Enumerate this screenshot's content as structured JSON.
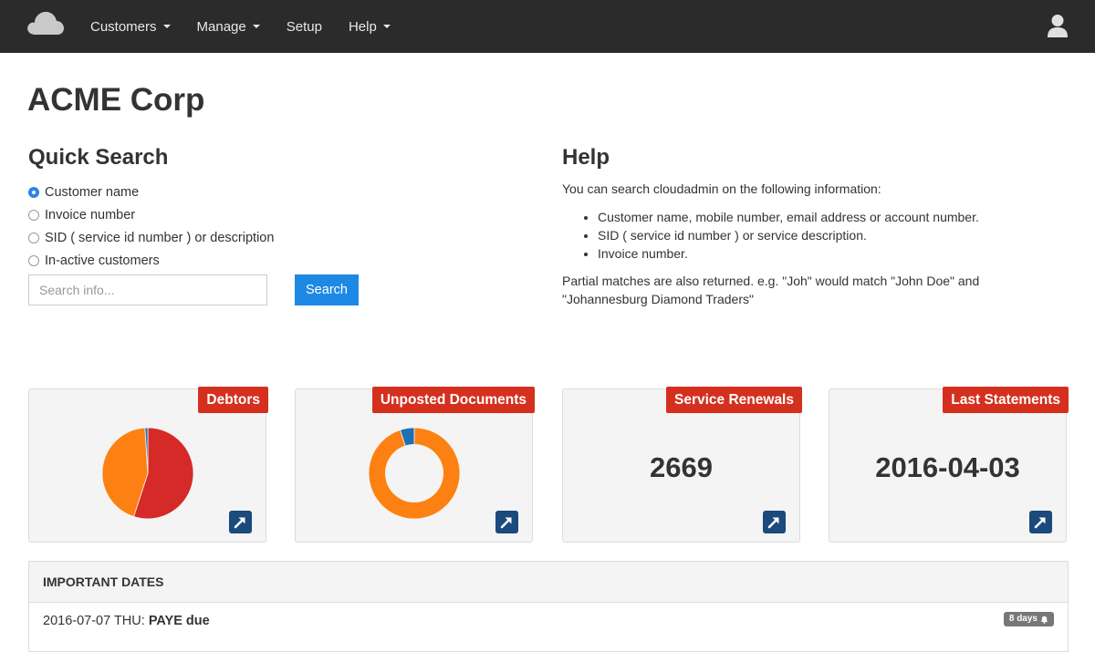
{
  "nav": {
    "items": [
      {
        "label": "Customers",
        "dropdown": true
      },
      {
        "label": "Manage",
        "dropdown": true
      },
      {
        "label": "Setup",
        "dropdown": false
      },
      {
        "label": "Help",
        "dropdown": true
      }
    ],
    "logo_icon": "cloud-icon",
    "user_icon": "user-icon"
  },
  "page": {
    "title": "ACME Corp"
  },
  "quick_search": {
    "title": "Quick Search",
    "options": [
      {
        "label": "Customer name",
        "checked": true
      },
      {
        "label": "Invoice number",
        "checked": false
      },
      {
        "label": "SID ( service id number ) or description",
        "checked": false
      },
      {
        "label": "In-active customers",
        "checked": false
      }
    ],
    "input_value": "",
    "placeholder": "Search info...",
    "button_label": "Search"
  },
  "help": {
    "title": "Help",
    "intro": "You can search cloudadmin on the following information:",
    "items": [
      "Customer name, mobile number, email address or account number.",
      "SID ( service id number ) or service description.",
      "Invoice number."
    ],
    "note": "Partial matches are also returned. e.g. \"Joh\" would match \"John Doe\" and \"Johannesburg Diamond Traders\""
  },
  "cards": {
    "debtors": {
      "label": "Debtors"
    },
    "unposted": {
      "label": "Unposted Documents"
    },
    "renewals": {
      "label": "Service Renewals",
      "value": "2669"
    },
    "statements": {
      "label": "Last Statements",
      "value": "2016-04-03"
    }
  },
  "chart_data": [
    {
      "type": "pie",
      "title": "Debtors",
      "values": [
        55,
        44,
        1
      ],
      "colors": [
        "#d62a28",
        "#fd8112",
        "#1f6fb2"
      ]
    },
    {
      "type": "pie",
      "title": "Unposted Documents",
      "donut": true,
      "values": [
        95,
        5
      ],
      "colors": [
        "#fd8112",
        "#1f6fb2"
      ]
    }
  ],
  "important_dates": {
    "title": "IMPORTANT DATES",
    "rows": [
      {
        "date": "2016-07-07 THU:",
        "event": "PAYE due",
        "badge": "8 days"
      }
    ]
  },
  "colors": {
    "navbar": "#2b2b2b",
    "badge": "#d5301e",
    "primary": "#1e88e5",
    "link_button": "#1b4a7c"
  }
}
